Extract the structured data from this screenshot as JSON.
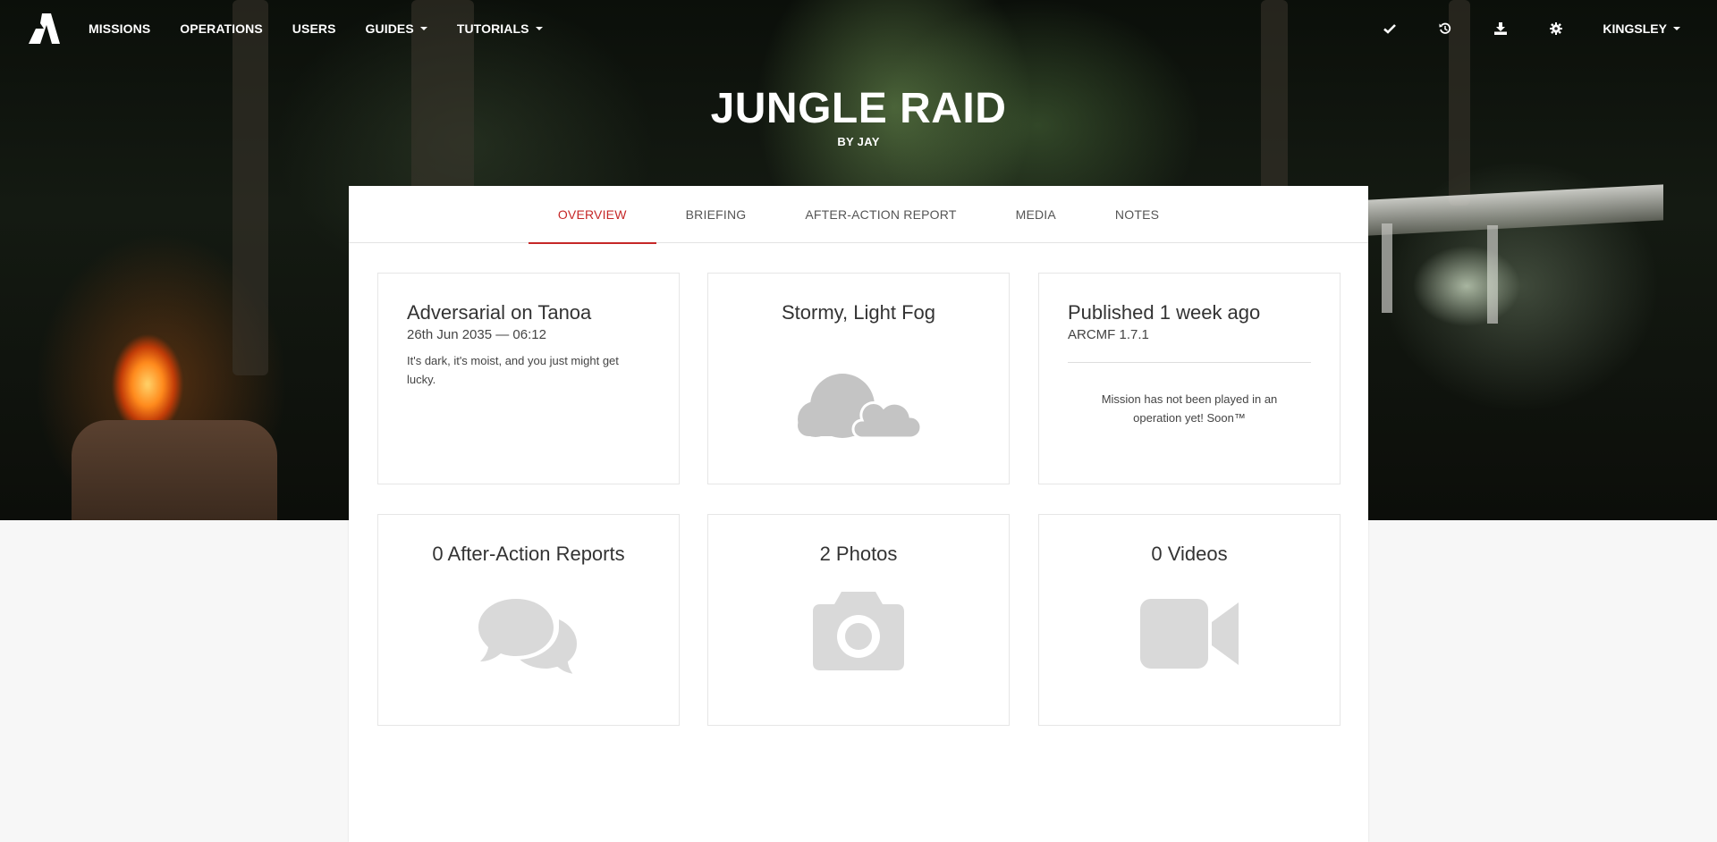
{
  "navbar": {
    "logo_icon": "arma-a-logo-icon",
    "items": [
      {
        "label": "MISSIONS",
        "has_dropdown": false
      },
      {
        "label": "OPERATIONS",
        "has_dropdown": false
      },
      {
        "label": "USERS",
        "has_dropdown": false
      },
      {
        "label": "GUIDES",
        "has_dropdown": true
      },
      {
        "label": "TUTORIALS",
        "has_dropdown": true
      }
    ],
    "right_icons": [
      "check-icon",
      "history-icon",
      "download-icon",
      "gear-icon"
    ],
    "user": {
      "label": "KINGSLEY",
      "has_dropdown": true
    }
  },
  "mission": {
    "title": "JUNGLE RAID",
    "byline": "BY JAY"
  },
  "tabs": [
    {
      "label": "OVERVIEW",
      "active": true
    },
    {
      "label": "BRIEFING",
      "active": false
    },
    {
      "label": "AFTER-ACTION REPORT",
      "active": false
    },
    {
      "label": "MEDIA",
      "active": false
    },
    {
      "label": "NOTES",
      "active": false
    }
  ],
  "cards": {
    "map": {
      "title": "Adversarial on Tanoa",
      "datetime": "26th Jun 2035 — 06:12",
      "description": "It's dark, it's moist, and you just might get lucky."
    },
    "weather": {
      "title": "Stormy, Light Fog",
      "icon": "cloud-icon"
    },
    "published": {
      "title": "Published 1 week ago",
      "version": "ARCMF 1.7.1",
      "note": "Mission has not been played in an operation yet! Soon™"
    },
    "reports": {
      "title": "0 After-Action Reports",
      "icon": "comments-icon"
    },
    "photos": {
      "title": "2 Photos",
      "icon": "camera-icon"
    },
    "videos": {
      "title": "0 Videos",
      "icon": "video-camera-icon"
    }
  },
  "colors": {
    "accent": "#c62828",
    "icon_gray": "#d9d9d9",
    "weather_icon_gray": "#c4c4c4"
  }
}
